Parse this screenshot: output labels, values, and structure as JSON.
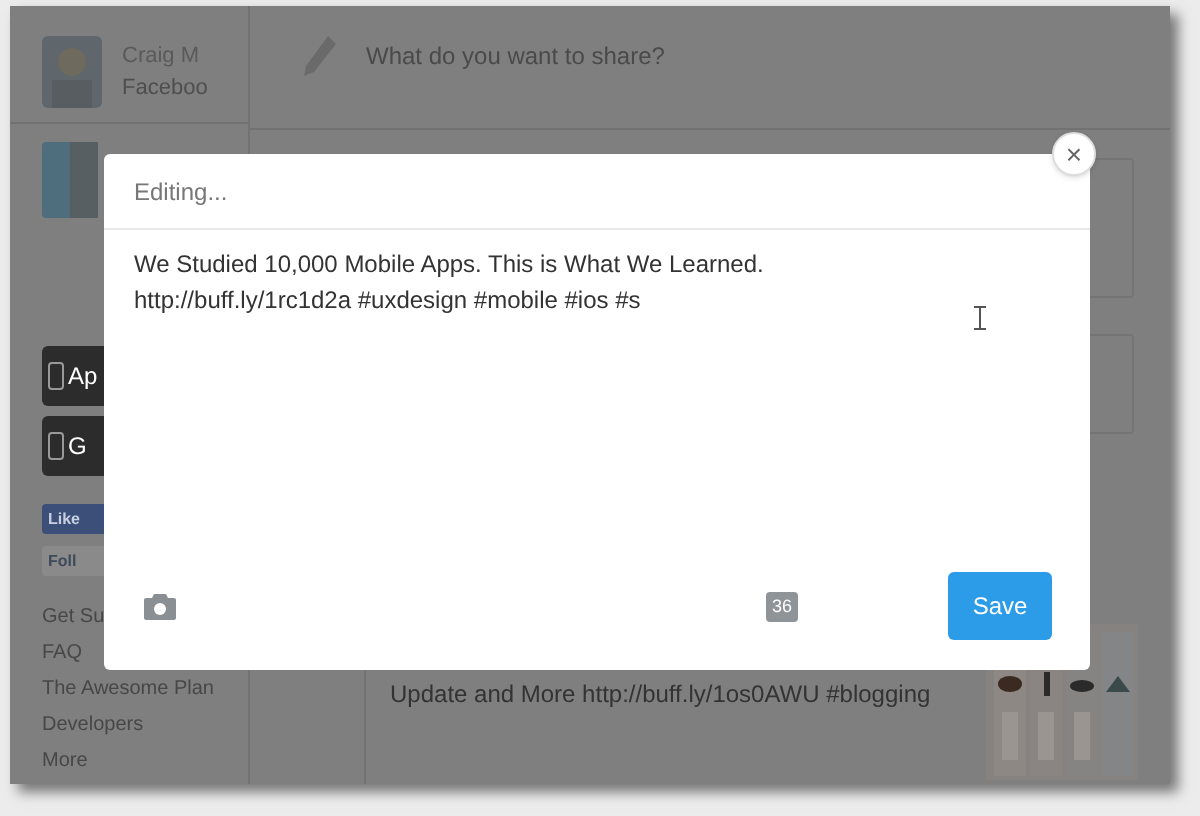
{
  "sidebar": {
    "profile": {
      "name": "Craig M",
      "network": "Faceboo"
    },
    "app_badges": [
      "Ap",
      "G"
    ],
    "social_buttons": [
      "Like",
      "Foll"
    ],
    "links": [
      "Get Su",
      "FAQ",
      "The Awesome Plan",
      "Developers",
      "More"
    ]
  },
  "composer": {
    "placeholder": "What do you want to share?"
  },
  "posts": [
    {
      "text": "Update and More http://buff.ly/1os0AWU #blogging"
    }
  ],
  "dialog": {
    "title": "Editing...",
    "text": "We Studied 10,000 Mobile Apps. This is What We Learned. http://buff.ly/1rc1d2a #uxdesign #mobile #ios #s",
    "char_count": "36",
    "save_button": "Save",
    "close": "×"
  }
}
